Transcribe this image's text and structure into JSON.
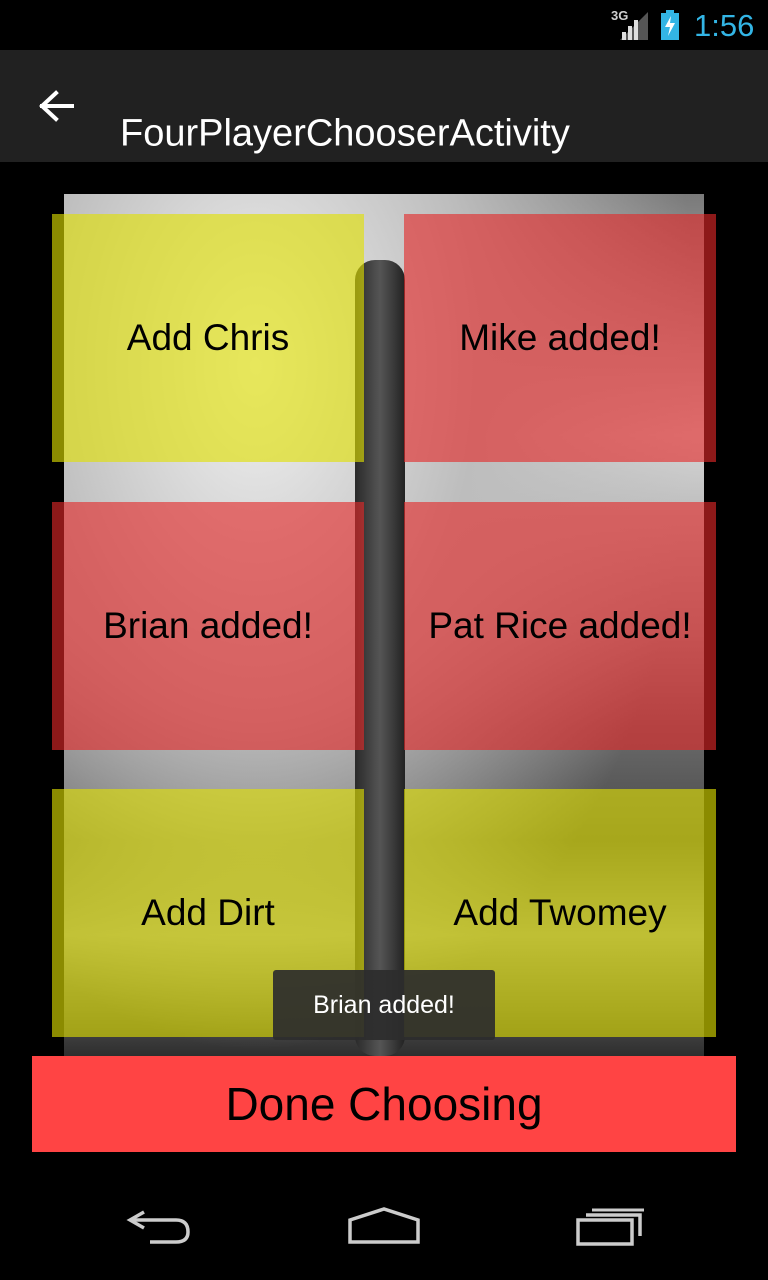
{
  "status_bar": {
    "network": "3G",
    "time": "1:56",
    "icons": [
      "signal-icon",
      "battery-charging-icon"
    ]
  },
  "action_bar": {
    "title": "FourPlayerChooserActivity",
    "back_icon": "arrow-left-icon"
  },
  "tiles": [
    {
      "label": "Add Chris",
      "state": "not-added",
      "color": "#e0e000"
    },
    {
      "label": "Mike added!",
      "state": "added",
      "color": "#e42828"
    },
    {
      "label": "Brian added!",
      "state": "added",
      "color": "#e42828"
    },
    {
      "label": "Pat Rice added!",
      "state": "added",
      "color": "#e42828"
    },
    {
      "label": "Add Dirt",
      "state": "not-added",
      "color": "#e0e000"
    },
    {
      "label": "Add Twomey",
      "state": "not-added",
      "color": "#e0e000"
    }
  ],
  "toast": {
    "text": "Brian added!"
  },
  "done_button": {
    "label": "Done Choosing",
    "color": "#ff4444"
  },
  "nav_bar": {
    "icons": [
      "back-icon",
      "home-icon",
      "recent-apps-icon"
    ]
  },
  "colors": {
    "clock": "#33b5e5",
    "action_bar_bg": "#212121"
  }
}
